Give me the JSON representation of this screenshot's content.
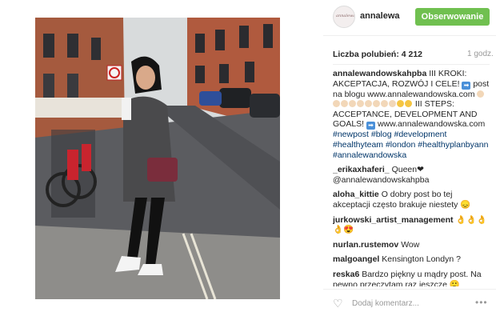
{
  "header": {
    "avatar_text": "annalewandowska",
    "username": "annalewa",
    "follow_label": "Obserwowanie"
  },
  "meta": {
    "likes": "Liczba polubień: 4 212",
    "time": "1 godz."
  },
  "caption": {
    "user": "annalewandowskahpba",
    "line1": "III KROKI: AKCEPTACJA, ROZWÓJ I CELE!",
    "line2": "post na blogu www.annalewandowska.com",
    "line3": "III STEPS: ACCEPTANCE, DEVELOPMENT AND GOALS!",
    "line4": "www.annalewandowska.com",
    "tags": "#newpost #blog #development #healthyteam #london #healthyplanbyann #annalewandowska"
  },
  "comments": [
    {
      "user": "_erikaxhaferi_",
      "text": "Queen❤ @annalewandowskahpba"
    },
    {
      "user": "aloha_kittie",
      "text": "O dobry post bo tej akceptacji często brakuje niestety 😞"
    },
    {
      "user": "jurkowski_artist_management",
      "text": "👌👌👌 👌😍"
    },
    {
      "user": "nurlan.rustemov",
      "text": "Wow"
    },
    {
      "user": "malgoangel",
      "text": "Kensington Londyn ?"
    },
    {
      "user": "reska6",
      "text": "Bardzo piękny u mądry post. Na pewno przeczytam raz jeszcze 🙂"
    }
  ],
  "footer": {
    "heart_icon": "heart-icon",
    "add_comment_placeholder": "Dodaj komentarz...",
    "more_icon": "more-icon"
  },
  "colors": {
    "follow_bg": "#70c050",
    "tag": "#003569"
  }
}
